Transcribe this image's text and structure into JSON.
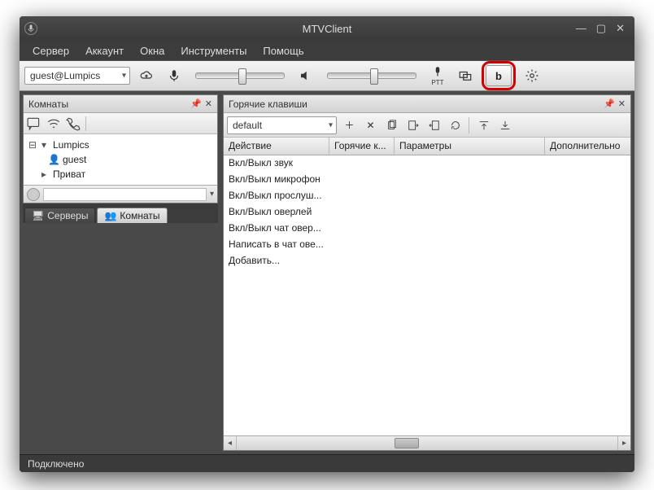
{
  "window": {
    "title": "MTVClient"
  },
  "menu": {
    "items": [
      "Сервер",
      "Аккаунт",
      "Окна",
      "Инструменты",
      "Помощь"
    ]
  },
  "toolbar": {
    "account_combo": "guest@Lumpics",
    "ptt_label": "PTT",
    "overlay_button_glyph": "b"
  },
  "rooms_panel": {
    "title": "Комнаты",
    "tree": {
      "server": "Lumpics",
      "user": "guest",
      "private": "Приват"
    },
    "tabs": {
      "servers": "Серверы",
      "rooms": "Комнаты"
    }
  },
  "hotkeys_panel": {
    "title": "Горячие клавиши",
    "profile_combo": "default",
    "columns": [
      "Действие",
      "Горячие к...",
      "Параметры",
      "Дополнительно"
    ],
    "rows": [
      "Вкл/Выкл звук",
      "Вкл/Выкл микрофон",
      "Вкл/Выкл прослуш...",
      "Вкл/Выкл оверлей",
      "Вкл/Выкл чат овер...",
      "Написать в чат ове...",
      "Добавить..."
    ]
  },
  "status": {
    "text": "Подключено"
  }
}
